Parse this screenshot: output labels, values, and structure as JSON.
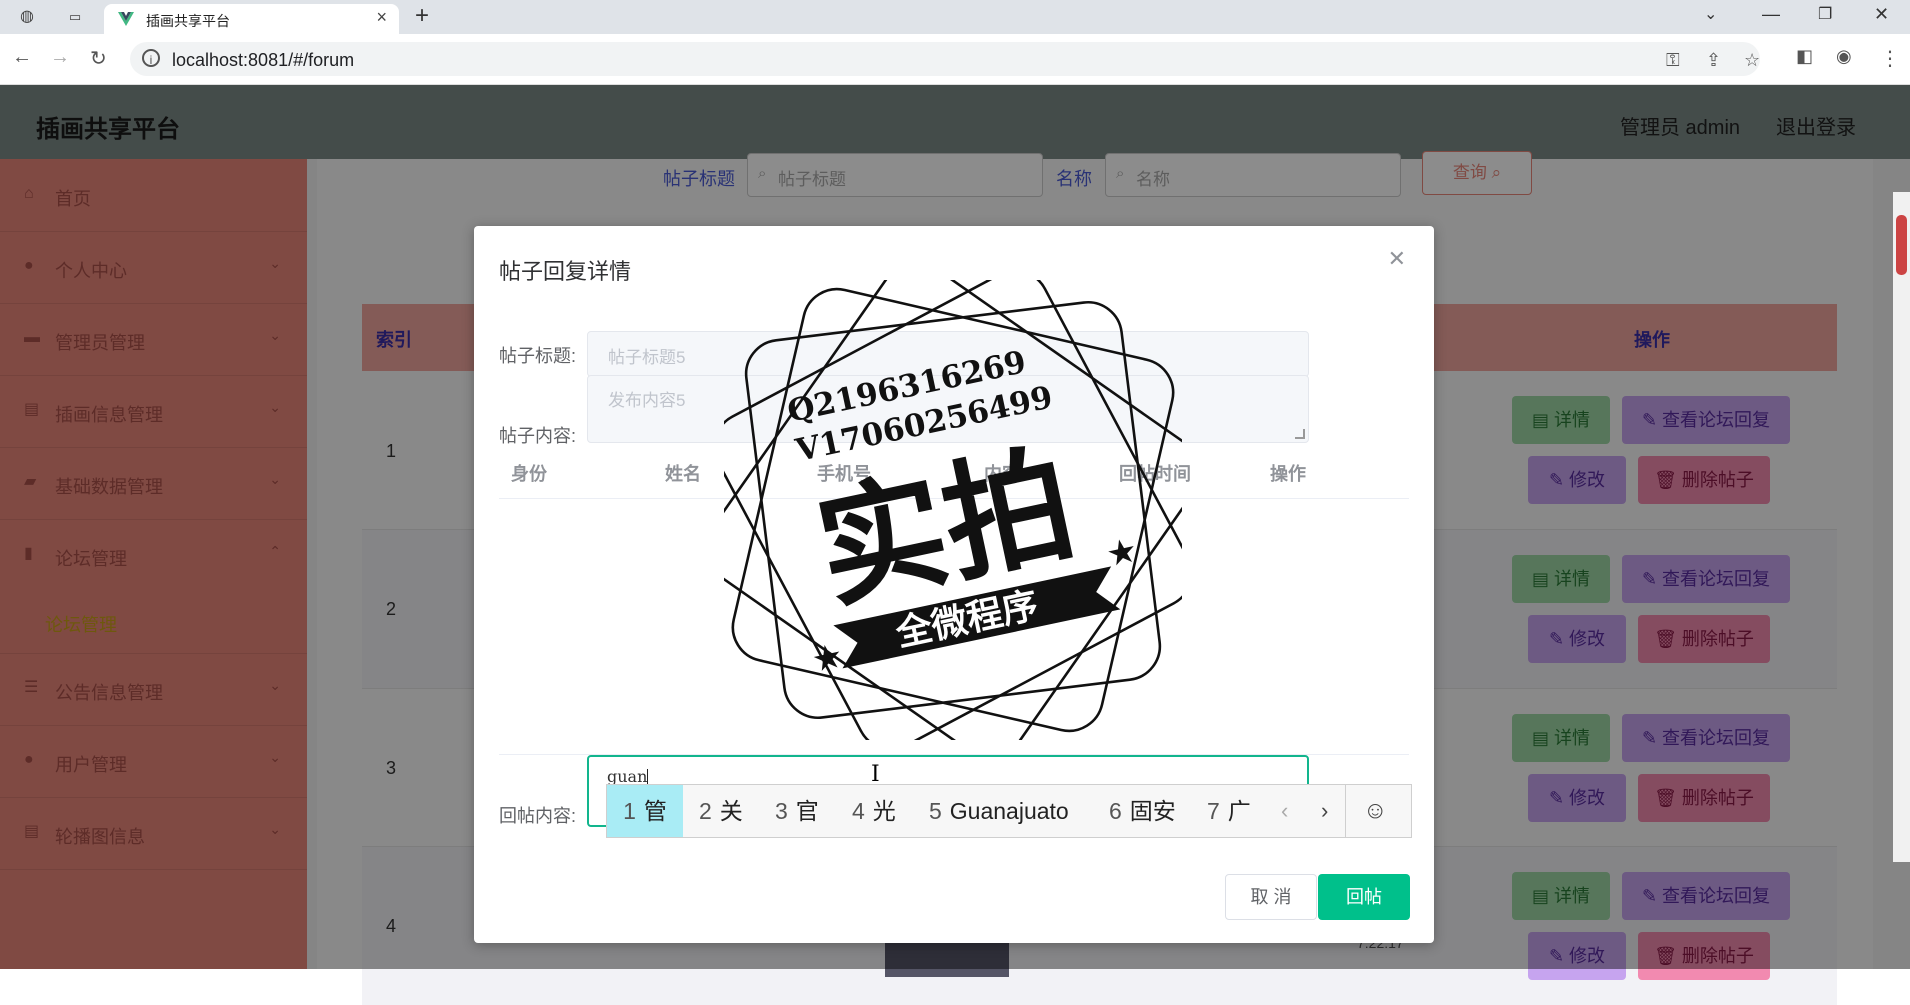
{
  "browser": {
    "tab_title": "插画共享平台",
    "url": "localhost:8081/#/forum"
  },
  "header": {
    "brand": "插画共享平台",
    "user": "管理员 admin",
    "logout": "退出登录"
  },
  "sidebar": {
    "items": [
      {
        "label": "首页",
        "icon": "home-icon",
        "expandable": false
      },
      {
        "label": "个人中心",
        "icon": "user-icon",
        "expandable": true
      },
      {
        "label": "管理员管理",
        "icon": "briefcase-icon",
        "expandable": true
      },
      {
        "label": "插画信息管理",
        "icon": "clipboard-icon",
        "expandable": true
      },
      {
        "label": "基础数据管理",
        "icon": "printer-icon",
        "expandable": true
      },
      {
        "label": "论坛管理",
        "icon": "bar-chart-icon",
        "expandable": true,
        "expanded": true
      },
      {
        "label": "公告信息管理",
        "icon": "list-icon",
        "expandable": true
      },
      {
        "label": "用户管理",
        "icon": "person-icon",
        "expandable": true
      },
      {
        "label": "轮播图信息",
        "icon": "clipboard-icon",
        "expandable": true
      }
    ],
    "sub_item": "论坛管理"
  },
  "search": {
    "title_label": "帖子标题",
    "title_placeholder": "帖子标题",
    "name_label": "名称",
    "name_placeholder": "名称",
    "query_btn": "查询"
  },
  "table": {
    "col_index": "索引",
    "col_ops": "操作",
    "rows": [
      "1",
      "2",
      "3",
      "4"
    ],
    "btn_detail": "详情",
    "btn_view_replies": "查看论坛回复",
    "btn_edit": "修改",
    "btn_delete": "删除帖子",
    "partial_time": "7:22:17"
  },
  "dialog": {
    "title": "帖子回复详情",
    "post_title_label": "帖子标题:",
    "post_title_value": "帖子标题5",
    "post_content_label": "帖子内容:",
    "post_content_value": "发布内容5",
    "reply_cols": [
      "身份",
      "姓名",
      "手机号",
      "内容",
      "回帖时间",
      "操作"
    ],
    "reply_label": "回帖内容:",
    "reply_value": "guan",
    "cancel": "取 消",
    "submit": "回帖"
  },
  "ime": {
    "candidates": [
      {
        "n": "1",
        "t": "管"
      },
      {
        "n": "2",
        "t": "关"
      },
      {
        "n": "3",
        "t": "官"
      },
      {
        "n": "4",
        "t": "光"
      },
      {
        "n": "5",
        "t": "Guanajuato"
      },
      {
        "n": "6",
        "t": "固安"
      },
      {
        "n": "7",
        "t": "广"
      }
    ]
  },
  "watermark": {
    "line1": "Q2196316269",
    "line2": "V17060256499",
    "main": "实拍",
    "banner": "全微程序"
  },
  "colors": {
    "header": "#7d8b87",
    "sidebar": "#e9877b",
    "accent": "#00c08b",
    "table_header": "#f0a79f"
  }
}
